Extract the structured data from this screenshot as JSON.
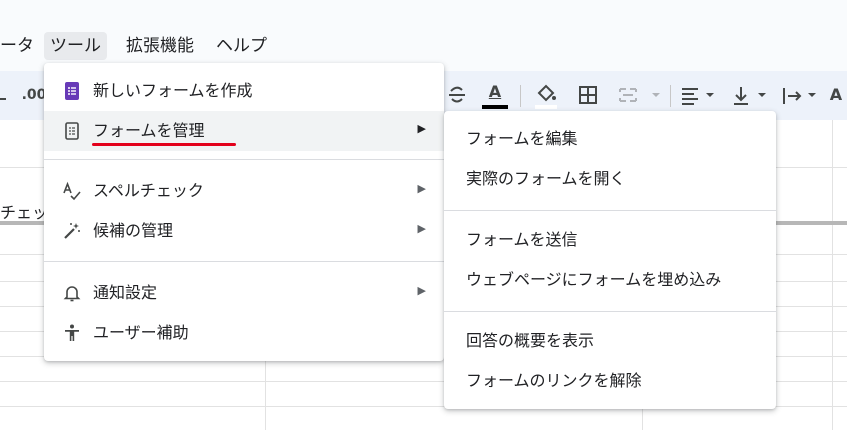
{
  "menubar": {
    "data_label": "ータ",
    "tools_label": "ツール",
    "extensions_label": "拡張機能",
    "help_label": "ヘルプ"
  },
  "toolbar": {
    "decimal_label": ".00",
    "text_color_label": "A",
    "more_label": "A"
  },
  "sheet": {
    "cell_text": "チェッ"
  },
  "tools_menu": {
    "items": [
      {
        "label": "新しいフォームを作成",
        "icon": "google-forms-icon"
      },
      {
        "label": "フォームを管理",
        "icon": "form-manage-icon"
      },
      {
        "label": "スペルチェック",
        "icon": "spellcheck-icon"
      },
      {
        "label": "候補の管理",
        "icon": "magic-wand-icon"
      },
      {
        "label": "通知設定",
        "icon": "bell-icon"
      },
      {
        "label": "ユーザー補助",
        "icon": "accessibility-icon"
      }
    ]
  },
  "forms_submenu": {
    "items": [
      {
        "label": "フォームを編集"
      },
      {
        "label": "実際のフォームを開く"
      },
      {
        "label": "フォームを送信"
      },
      {
        "label": "ウェブページにフォームを埋め込み"
      },
      {
        "label": "回答の概要を表示"
      },
      {
        "label": "フォームのリンクを解除"
      }
    ]
  },
  "colors": {
    "highlight_underline": "#e3001b",
    "forms_icon": "#673ab7",
    "toolbar_bg": "#edf2fa"
  }
}
